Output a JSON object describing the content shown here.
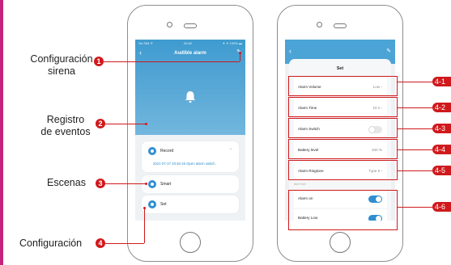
{
  "left_phone": {
    "status_left": "No SIM ✈",
    "status_time": "20:48",
    "status_right": "✈ ✦ 100% ▬",
    "title": "Audible alarm",
    "rows": [
      {
        "label": "Record",
        "sub": "2021-07-27 20:46:19 Open alarm switch"
      },
      {
        "label": "Smart"
      },
      {
        "label": "Set"
      }
    ]
  },
  "right_phone": {
    "title": "Set",
    "settings": [
      {
        "label": "Alarm Volume",
        "value": "Low"
      },
      {
        "label": "Alarm Time",
        "value": "10 s"
      },
      {
        "label": "Alarm Switch",
        "toggle": "off"
      },
      {
        "label": "Battery level",
        "value": "100 %"
      },
      {
        "label": "Alarm Ringtone",
        "value": "Type 6"
      }
    ],
    "alert_header": "Alert Set",
    "alerts": [
      {
        "label": "Alarm on",
        "toggle": "on"
      },
      {
        "label": "Battery Low",
        "toggle": "on"
      }
    ]
  },
  "callouts": {
    "c1": {
      "text_line1": "Configuración",
      "text_line2": "sirena",
      "number": "1"
    },
    "c2": {
      "text_line1": "Registro",
      "text_line2": "de eventos",
      "number": "2"
    },
    "c3": {
      "text": "Escenas",
      "number": "3"
    },
    "c4": {
      "text": "Configuración",
      "number": "4"
    }
  },
  "tags": [
    "4-1",
    "4-2",
    "4-3",
    "4-4",
    "4-5",
    "4-6"
  ],
  "colors": {
    "accent_red": "#d0191c",
    "app_blue": "#3f9bd0",
    "border_magenta": "#c6247d"
  }
}
